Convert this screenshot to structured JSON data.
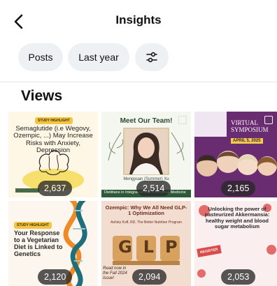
{
  "header": {
    "title": "Insights"
  },
  "filters": {
    "posts_label": "Posts",
    "period_label": "Last year"
  },
  "section": {
    "title": "Views"
  },
  "icons": {
    "back": "chevron-left-icon",
    "filter": "sliders-icon"
  },
  "posts": [
    {
      "tag": "STUDY HIGHLIGHT",
      "headline": "Semaglutide (i.e Wegovy, Ozempic, ...) May Increase Risks with Anxiety, Depression",
      "views": "2,637"
    },
    {
      "headline": "Meet Our Team!",
      "caption": "Mengyuan (Summer) Xu",
      "footer": "Dietitians in Integrative and Functional Medicine",
      "views": "2,514"
    },
    {
      "headline": "VIRTUAL SYMPOSIUM",
      "date": "APRIL 5, 2025",
      "views": "2,165"
    },
    {
      "tag": "STUDY HIGHLIGHT",
      "headline": "Your Response to a Vegetarian Diet is Linked to Genetics",
      "views": "2,120"
    },
    {
      "headline": "Ozempic: Why We All Need GLP-1 Optimization",
      "byline": "Ashley Koff, RD, The Better Nutrition Program",
      "big": "GLP",
      "note": "Read now in the Fall 2024 Issue!",
      "views": "2,094"
    },
    {
      "headline": "Unlocking the power of pasteurized Akkermansia: healthy weight and blood sugar metabolism",
      "badge": "REGISTER",
      "views": "2,053"
    }
  ],
  "colors": {
    "chip_bg": "#eef1f4",
    "pill_bg": "#282828",
    "symposium": "#6a2c70",
    "dna_orange": "#f08a24",
    "dna_teal": "#1f6f7a"
  }
}
